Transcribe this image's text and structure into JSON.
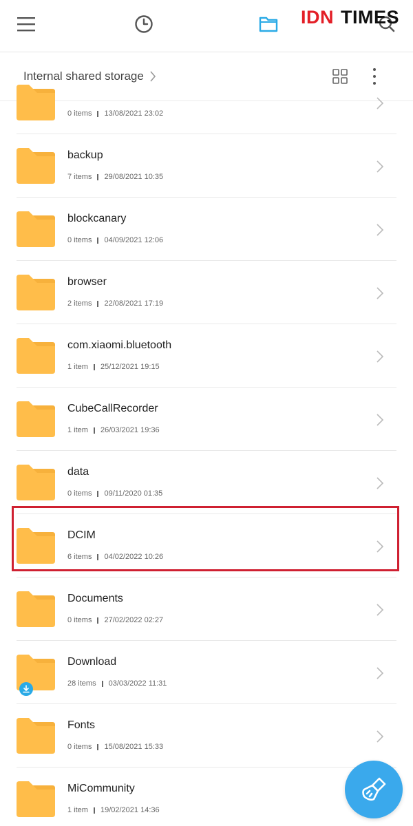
{
  "watermark": {
    "brand_red": "IDN",
    "brand_dark": "TIMES"
  },
  "topbar": {
    "icons": [
      "menu-icon",
      "recent-clock-icon",
      "files-folder-icon",
      "search-icon"
    ],
    "active_color": "#2aaae6"
  },
  "path": {
    "label": "Internal shared storage"
  },
  "folder_color": "#ffbd4a",
  "folders": [
    {
      "name": "",
      "items": "0 items",
      "date": "13/08/2021 23:02"
    },
    {
      "name": "backup",
      "items": "7 items",
      "date": "29/08/2021 10:35"
    },
    {
      "name": "blockcanary",
      "items": "0 items",
      "date": "04/09/2021 12:06"
    },
    {
      "name": "browser",
      "items": "2 items",
      "date": "22/08/2021 17:19"
    },
    {
      "name": "com.xiaomi.bluetooth",
      "items": "1 item",
      "date": "25/12/2021 19:15"
    },
    {
      "name": "CubeCallRecorder",
      "items": "1 item",
      "date": "26/03/2021 19:36"
    },
    {
      "name": "data",
      "items": "0 items",
      "date": "09/11/2020 01:35"
    },
    {
      "name": "DCIM",
      "items": "6 items",
      "date": "04/02/2022 10:26"
    },
    {
      "name": "Documents",
      "items": "0 items",
      "date": "27/02/2022 02:27"
    },
    {
      "name": "Download",
      "items": "28 items",
      "date": "03/03/2022 11:31"
    },
    {
      "name": "Fonts",
      "items": "0 items",
      "date": "15/08/2021 15:33"
    },
    {
      "name": "MiCommunity",
      "items": "1 item",
      "date": "19/02/2021 14:36"
    }
  ],
  "highlight_color": "#cf2031",
  "fab": {
    "icon": "cleaner-brush-icon",
    "color": "#3aa9ec"
  }
}
